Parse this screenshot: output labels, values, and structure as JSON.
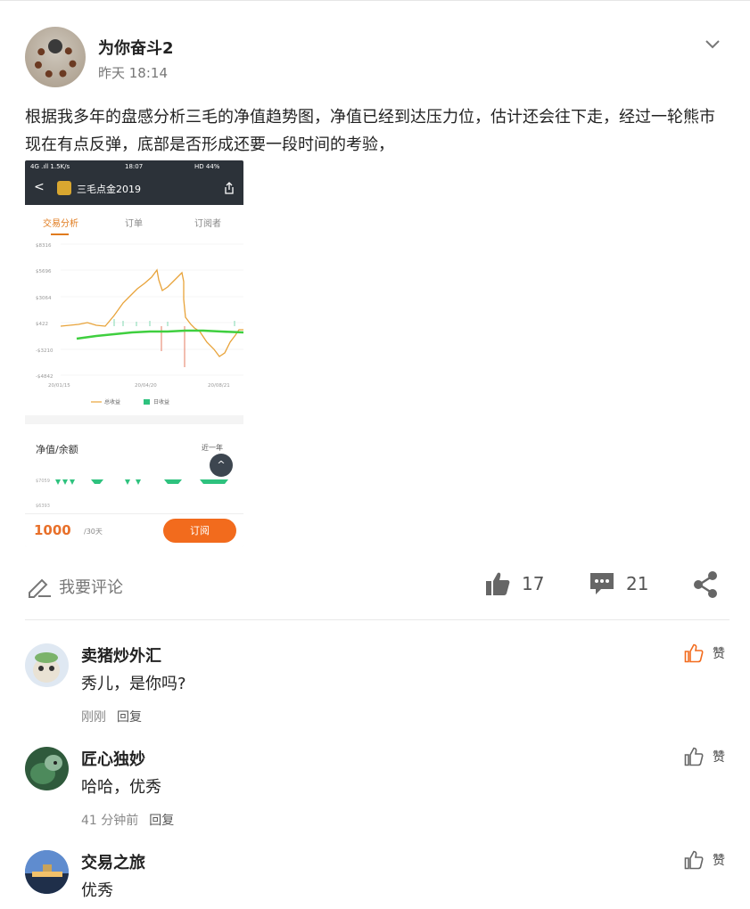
{
  "post": {
    "author": "为你奋斗2",
    "time": "昨天 18:14",
    "body": "根据我多年的盘感分析三毛的净值趋势图，净值已经到达压力位，估计还会往下走，经过一轮熊市现在有点反弹，底部是否形成还要一段时间的考验，",
    "screenshot": {
      "status_signal": "4G .ıll 1.5K/s",
      "status_time": "18:07",
      "status_right": "HD 44%",
      "nav_back": "<",
      "nav_title": "三毛点金2019",
      "tabs": [
        "交易分析",
        "订单",
        "订阅者"
      ],
      "chart": {
        "y_ticks": [
          "$8316",
          "$5696",
          "$3064",
          "$422",
          "-$3210",
          "-$4842"
        ],
        "x_ticks": [
          "20/01/15",
          "20/04/20",
          "20/08/21"
        ],
        "legend": [
          "总收益",
          "日收益"
        ],
        "colors": {
          "total": "#e8a33a",
          "daily_pos": "#2ec27e",
          "daily_neg": "#e05a3a",
          "trend": "#3fcf3f"
        }
      },
      "section_label": "净值/余额",
      "period_select": "近一年",
      "lower_tick_1": "$7059",
      "lower_tick_2": "$6393",
      "fab": "^",
      "price": "1000",
      "price_unit": "/30天",
      "subscribe": "订阅"
    }
  },
  "actions": {
    "comment_prompt": "我要评论",
    "likes": "17",
    "comments": "21"
  },
  "comments": [
    {
      "name": "卖猪炒外汇",
      "text": "秀儿，是你吗?",
      "time": "刚刚",
      "reply": "回复",
      "like_label": "赞",
      "liked": true
    },
    {
      "name": "匠心独妙",
      "text": "哈哈，优秀",
      "time": "41 分钟前",
      "reply": "回复",
      "like_label": "赞",
      "liked": false
    },
    {
      "name": "交易之旅",
      "text": "优秀",
      "like_label": "赞",
      "liked": false
    }
  ],
  "colors": {
    "accent": "#f26b1d",
    "liked": "#f26b1d",
    "icon_gray": "#666666"
  }
}
